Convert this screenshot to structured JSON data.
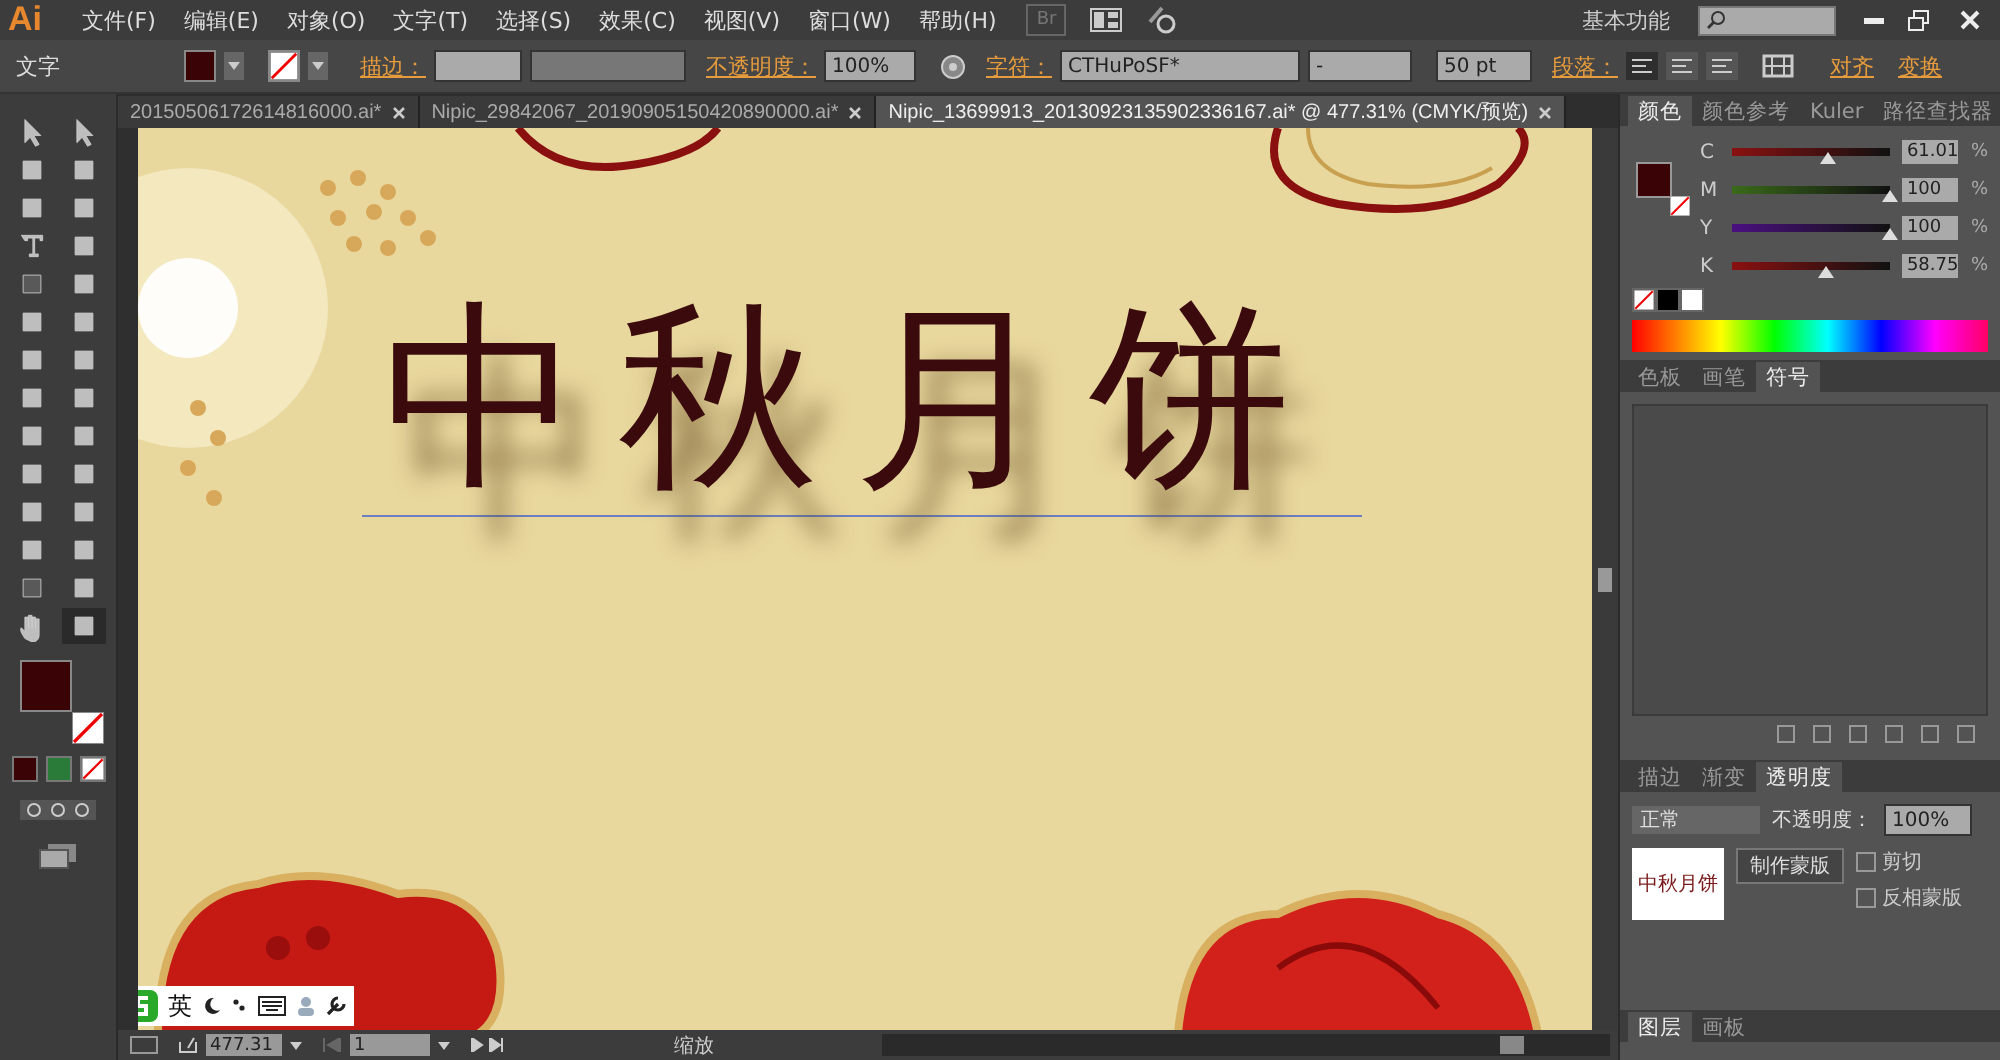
{
  "menu_bar": {
    "logo": "Ai",
    "items": [
      "文件(F)",
      "编辑(E)",
      "对象(O)",
      "文字(T)",
      "选择(S)",
      "效果(C)",
      "视图(V)",
      "窗口(W)",
      "帮助(H)"
    ],
    "bridge": "Br",
    "workspace": "基本功能"
  },
  "control_bar": {
    "mode": "文字",
    "stroke_label": "描边：",
    "opacity_label": "不透明度：",
    "opacity": "100%",
    "character_label": "字符：",
    "font": "CTHuPoSF*",
    "style": "-",
    "size": "50 pt",
    "paragraph_label": "段落：",
    "align_link": "对齐",
    "transform_link": "变换"
  },
  "tabs": [
    {
      "label": "20150506172614816000.ai*",
      "selected": false
    },
    {
      "label": "Nipic_29842067_20190905150420890000.ai*",
      "selected": false
    },
    {
      "label": "Nipic_13699913_20130923135902336167.ai* @ 477.31% (CMYK/预览)",
      "selected": true
    }
  ],
  "canvas": {
    "headline": "中秋月饼"
  },
  "color_panel": {
    "tabs": [
      {
        "label": "颜色",
        "selected": true
      },
      {
        "label": "颜色参考",
        "selected": false
      },
      {
        "label": "Kuler",
        "selected": false
      },
      {
        "label": "路径查找器",
        "selected": false
      }
    ],
    "channels": [
      {
        "name": "C",
        "level": 0.61,
        "value": "61.01",
        "unit": "%"
      },
      {
        "name": "M",
        "level": 1,
        "value": "100",
        "unit": "%"
      },
      {
        "name": "Y",
        "level": 1,
        "value": "100",
        "unit": "%"
      },
      {
        "name": "K",
        "level": 0.59,
        "value": "58.75",
        "unit": "%"
      }
    ]
  },
  "symbols_panel": {
    "tabs": [
      {
        "label": "色板",
        "selected": false
      },
      {
        "label": "画笔",
        "selected": false
      },
      {
        "label": "符号",
        "selected": true
      }
    ]
  },
  "transparency_panel": {
    "tabs": [
      {
        "label": "描边",
        "selected": false
      },
      {
        "label": "渐变",
        "selected": false
      },
      {
        "label": "透明度",
        "selected": true
      }
    ],
    "blend_mode": "正常",
    "opacity_label": "不透明度：",
    "opacity": "100%",
    "thumbnail_text": "中秋月饼",
    "mask_button": "制作蒙版",
    "clip": "剪切",
    "clip_checked": false,
    "invert": "反相蒙版",
    "invert_checked": false
  },
  "layers_panel": {
    "tabs": [
      {
        "label": "图层",
        "selected": true
      },
      {
        "label": "画板",
        "selected": false
      }
    ]
  },
  "status_bar": {
    "zoom": "477.31",
    "artboard": "1",
    "tool": "缩放"
  },
  "ime_bar": {
    "language": "英"
  }
}
